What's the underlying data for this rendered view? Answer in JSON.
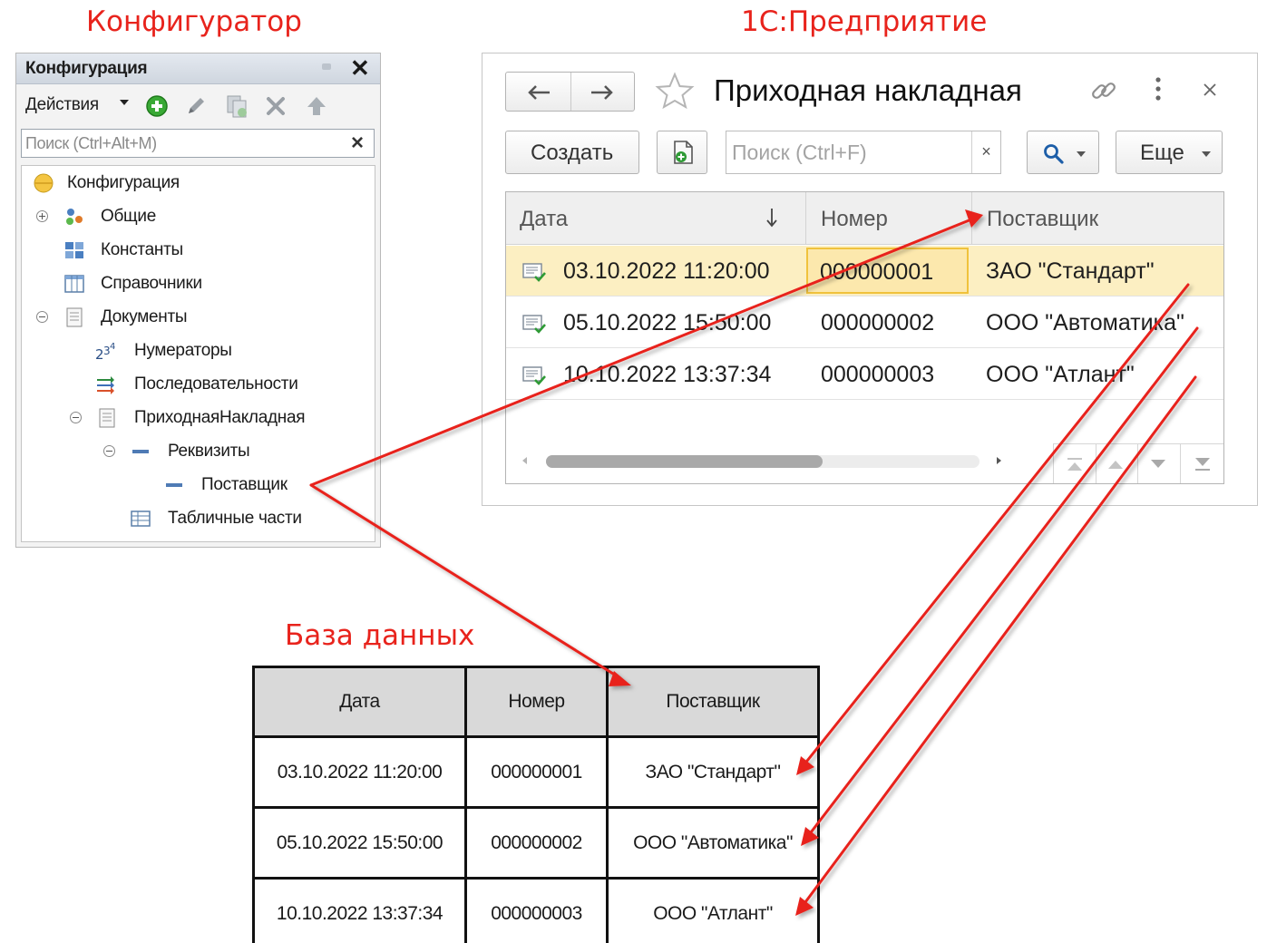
{
  "headings": {
    "configurator": "Конфигуратор",
    "enterprise": "1С:Предприятие",
    "database": "База данных"
  },
  "configurator_panel": {
    "title": "Конфигурация",
    "toolbar": {
      "actions_label": "Действия"
    },
    "search": {
      "placeholder": "Поиск (Ctrl+Alt+M)"
    },
    "tree": [
      "Конфигурация",
      "Общие",
      "Константы",
      "Справочники",
      "Документы",
      "Нумераторы",
      "Последовательности",
      "ПриходнаяНакладная",
      "Реквизиты",
      "Поставщик",
      "Табличные части"
    ]
  },
  "enterprise_window": {
    "title": "Приходная накладная",
    "create_label": "Создать",
    "search_placeholder": "Поиск (Ctrl+F)",
    "clear_label": "×",
    "more_label": "Еще",
    "columns": [
      "Дата",
      "Номер",
      "Поставщик"
    ],
    "rows": [
      {
        "date": "03.10.2022 11:20:00",
        "number": "000000001",
        "supplier": "ЗАО \"Стандарт\""
      },
      {
        "date": "05.10.2022 15:50:00",
        "number": "000000002",
        "supplier": "ООО \"Автоматика\""
      },
      {
        "date": "10.10.2022 13:37:34",
        "number": "000000003",
        "supplier": "ООО \"Атлант\""
      }
    ]
  },
  "database_table": {
    "columns": [
      "Дата",
      "Номер",
      "Поставщик"
    ],
    "rows": [
      [
        "03.10.2022 11:20:00",
        "000000001",
        "ЗАО \"Стандарт\""
      ],
      [
        "05.10.2022 15:50:00",
        "000000002",
        "ООО \"Автоматика\""
      ],
      [
        "10.10.2022 13:37:34",
        "000000003",
        "ООО \"Атлант\""
      ]
    ]
  },
  "colors": {
    "heading": "#e8231c",
    "arrow": "#e8231c",
    "selected_row": "#fcefc2",
    "selected_cell_border": "#f0c23c"
  }
}
